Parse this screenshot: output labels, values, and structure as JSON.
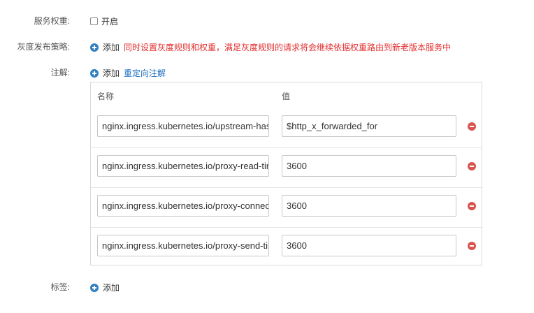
{
  "service_weight": {
    "label": "服务权重:",
    "checkbox_label": "开启",
    "checked": false
  },
  "gray_release": {
    "label": "灰度发布策略:",
    "add_label": "添加",
    "hint": "同时设置灰度规则和权重，满足灰度规则的请求将会继续依据权重路由到新老版本服务中"
  },
  "annotations": {
    "label": "注解:",
    "add_label": "添加",
    "redirect_link": "重定向注解",
    "col_name": "名称",
    "col_value": "值",
    "rows": [
      {
        "key": "nginx.ingress.kubernetes.io/upstream-hash-",
        "value": "$http_x_forwarded_for"
      },
      {
        "key": "nginx.ingress.kubernetes.io/proxy-read-time",
        "value": "3600"
      },
      {
        "key": "nginx.ingress.kubernetes.io/proxy-connect-",
        "value": "3600"
      },
      {
        "key": "nginx.ingress.kubernetes.io/proxy-send-tim",
        "value": "3600"
      }
    ]
  },
  "labels": {
    "label": "标签:",
    "add_label": "添加"
  },
  "colors": {
    "primary_blue": "#2f7fc1",
    "link_blue": "#1d6fc1",
    "hint_red": "#e22d2d",
    "remove_red": "#d9534f"
  }
}
